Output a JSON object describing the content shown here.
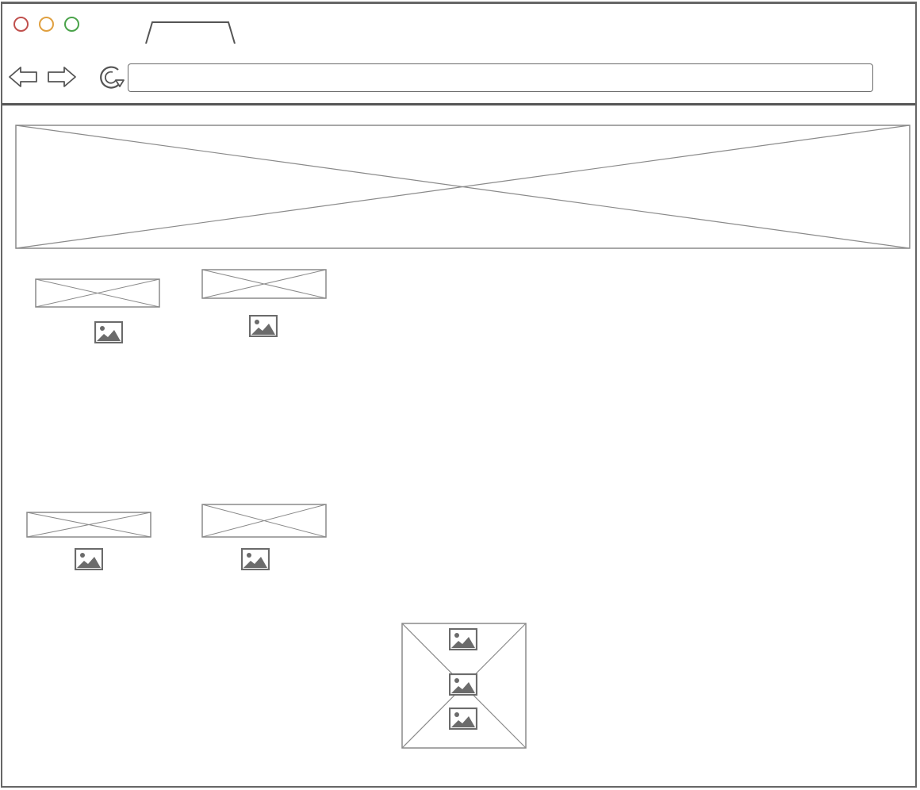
{
  "window": {
    "traffic_lights": {
      "close_color": "#c0504d",
      "minimize_color": "#e0a040",
      "zoom_color": "#4aa34a"
    },
    "tab": {
      "label": ""
    }
  },
  "toolbar": {
    "back_icon": "arrow-left-icon",
    "forward_icon": "arrow-right-icon",
    "reload_icon": "reload-icon",
    "address": {
      "value": "",
      "placeholder": ""
    }
  },
  "page": {
    "hero": {
      "kind": "image-placeholder"
    },
    "row_one": [
      {
        "kind": "image-placeholder",
        "icon": "image-icon"
      },
      {
        "kind": "image-placeholder",
        "icon": "image-icon"
      }
    ],
    "row_two": [
      {
        "kind": "image-placeholder",
        "icon": "image-icon"
      },
      {
        "kind": "image-placeholder",
        "icon": "image-icon"
      }
    ],
    "gallery": {
      "kind": "image-placeholder",
      "icons": [
        "image-icon",
        "image-icon",
        "image-icon"
      ]
    }
  },
  "colors": {
    "stroke": "#555555",
    "placeholder_stroke": "#8a8a8a",
    "icon_fill": "#6b6b6b"
  }
}
